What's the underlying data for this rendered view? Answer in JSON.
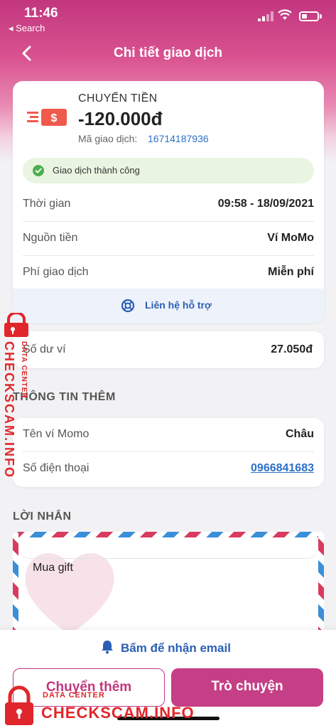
{
  "status_bar": {
    "time": "11:46",
    "back_app": "◂ Search"
  },
  "nav": {
    "title": "Chi tiết giao dịch"
  },
  "transaction": {
    "type": "CHUYỂN TIỀN",
    "amount": "-120.000đ",
    "code_label": "Mã giao dịch:",
    "code": "16714187936",
    "status": "Giao dịch thành công"
  },
  "details": [
    {
      "label": "Thời gian",
      "value": "09:58 - 18/09/2021"
    },
    {
      "label": "Nguồn tiền",
      "value": "Ví MoMo"
    },
    {
      "label": "Phí giao dịch",
      "value": "Miễn phí"
    }
  ],
  "support_label": "Liên hệ hỗ trợ",
  "balance": {
    "label": "Số dư ví",
    "value": "27.050đ"
  },
  "extra_section": {
    "title": "THÔNG TIN THÊM",
    "rows": [
      {
        "label": "Tên ví Momo",
        "value": "Châu"
      },
      {
        "label": "Số điện thoại",
        "value": "0966841683"
      }
    ]
  },
  "message_section": {
    "title": "LỜI NHẮN",
    "message": "Mua gift"
  },
  "bottom": {
    "email_label": "Bấm để nhận email",
    "transfer_more": "Chuyển thêm",
    "chat": "Trò chuyện"
  },
  "watermark": {
    "main": "CHECKSCAM.INFO",
    "sub": "DATA CENTER"
  },
  "colors": {
    "brand": "#c2367f",
    "link": "#2b70c9",
    "success": "#4caf50"
  }
}
